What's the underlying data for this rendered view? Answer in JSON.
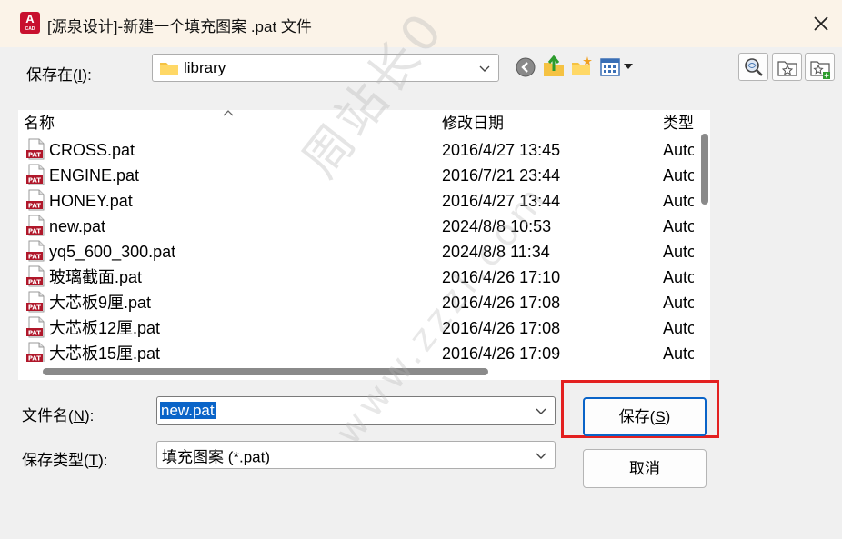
{
  "window": {
    "title": "[源泉设计]-新建一个填充图案 .pat 文件",
    "app_icon_letter": "A",
    "app_icon_sub": "CAD"
  },
  "save_in": {
    "label_prefix": "保存在(",
    "label_key": "I",
    "label_suffix": "):",
    "value": "library"
  },
  "toolbar_icons": [
    "back-icon",
    "up-folder-icon",
    "new-folder-icon",
    "views-menu-icon",
    "search-web-icon",
    "add-favorites-icon",
    "add-places-icon"
  ],
  "file_list": {
    "columns": [
      "名称",
      "修改日期",
      "类型"
    ],
    "rows": [
      {
        "name": "CROSS.pat",
        "date": "2016/4/27 13:45",
        "type": "Auto"
      },
      {
        "name": "ENGINE.pat",
        "date": "2016/7/21 23:44",
        "type": "Auto"
      },
      {
        "name": "HONEY.pat",
        "date": "2016/4/27 13:44",
        "type": "Auto"
      },
      {
        "name": "new.pat",
        "date": "2024/8/8 10:53",
        "type": "Auto"
      },
      {
        "name": "yq5_600_300.pat",
        "date": "2024/8/8 11:34",
        "type": "Auto"
      },
      {
        "name": "玻璃截面.pat",
        "date": "2016/4/26 17:10",
        "type": "Auto"
      },
      {
        "name": "大芯板9厘.pat",
        "date": "2016/4/26 17:08",
        "type": "Auto"
      },
      {
        "name": "大芯板12厘.pat",
        "date": "2016/4/26 17:08",
        "type": "Auto"
      },
      {
        "name": "大芯板15厘.pat",
        "date": "2016/4/26 17:09",
        "type": "Auto"
      }
    ]
  },
  "filename": {
    "label_prefix": "文件名(",
    "label_key": "N",
    "label_suffix": "):",
    "value": "new.pat"
  },
  "filetype": {
    "label_prefix": "保存类型(",
    "label_key": "T",
    "label_suffix": "):",
    "value": "填充图案 (*.pat)"
  },
  "buttons": {
    "save_prefix": "保存(",
    "save_key": "S",
    "save_suffix": ")",
    "cancel": "取消"
  },
  "watermark": {
    "line1": "周站长0",
    "line2": "www.zzzl.com"
  },
  "colors": {
    "accent": "#0a64c8",
    "highlight": "#e32020",
    "title_bg": "#fbf3e8"
  }
}
